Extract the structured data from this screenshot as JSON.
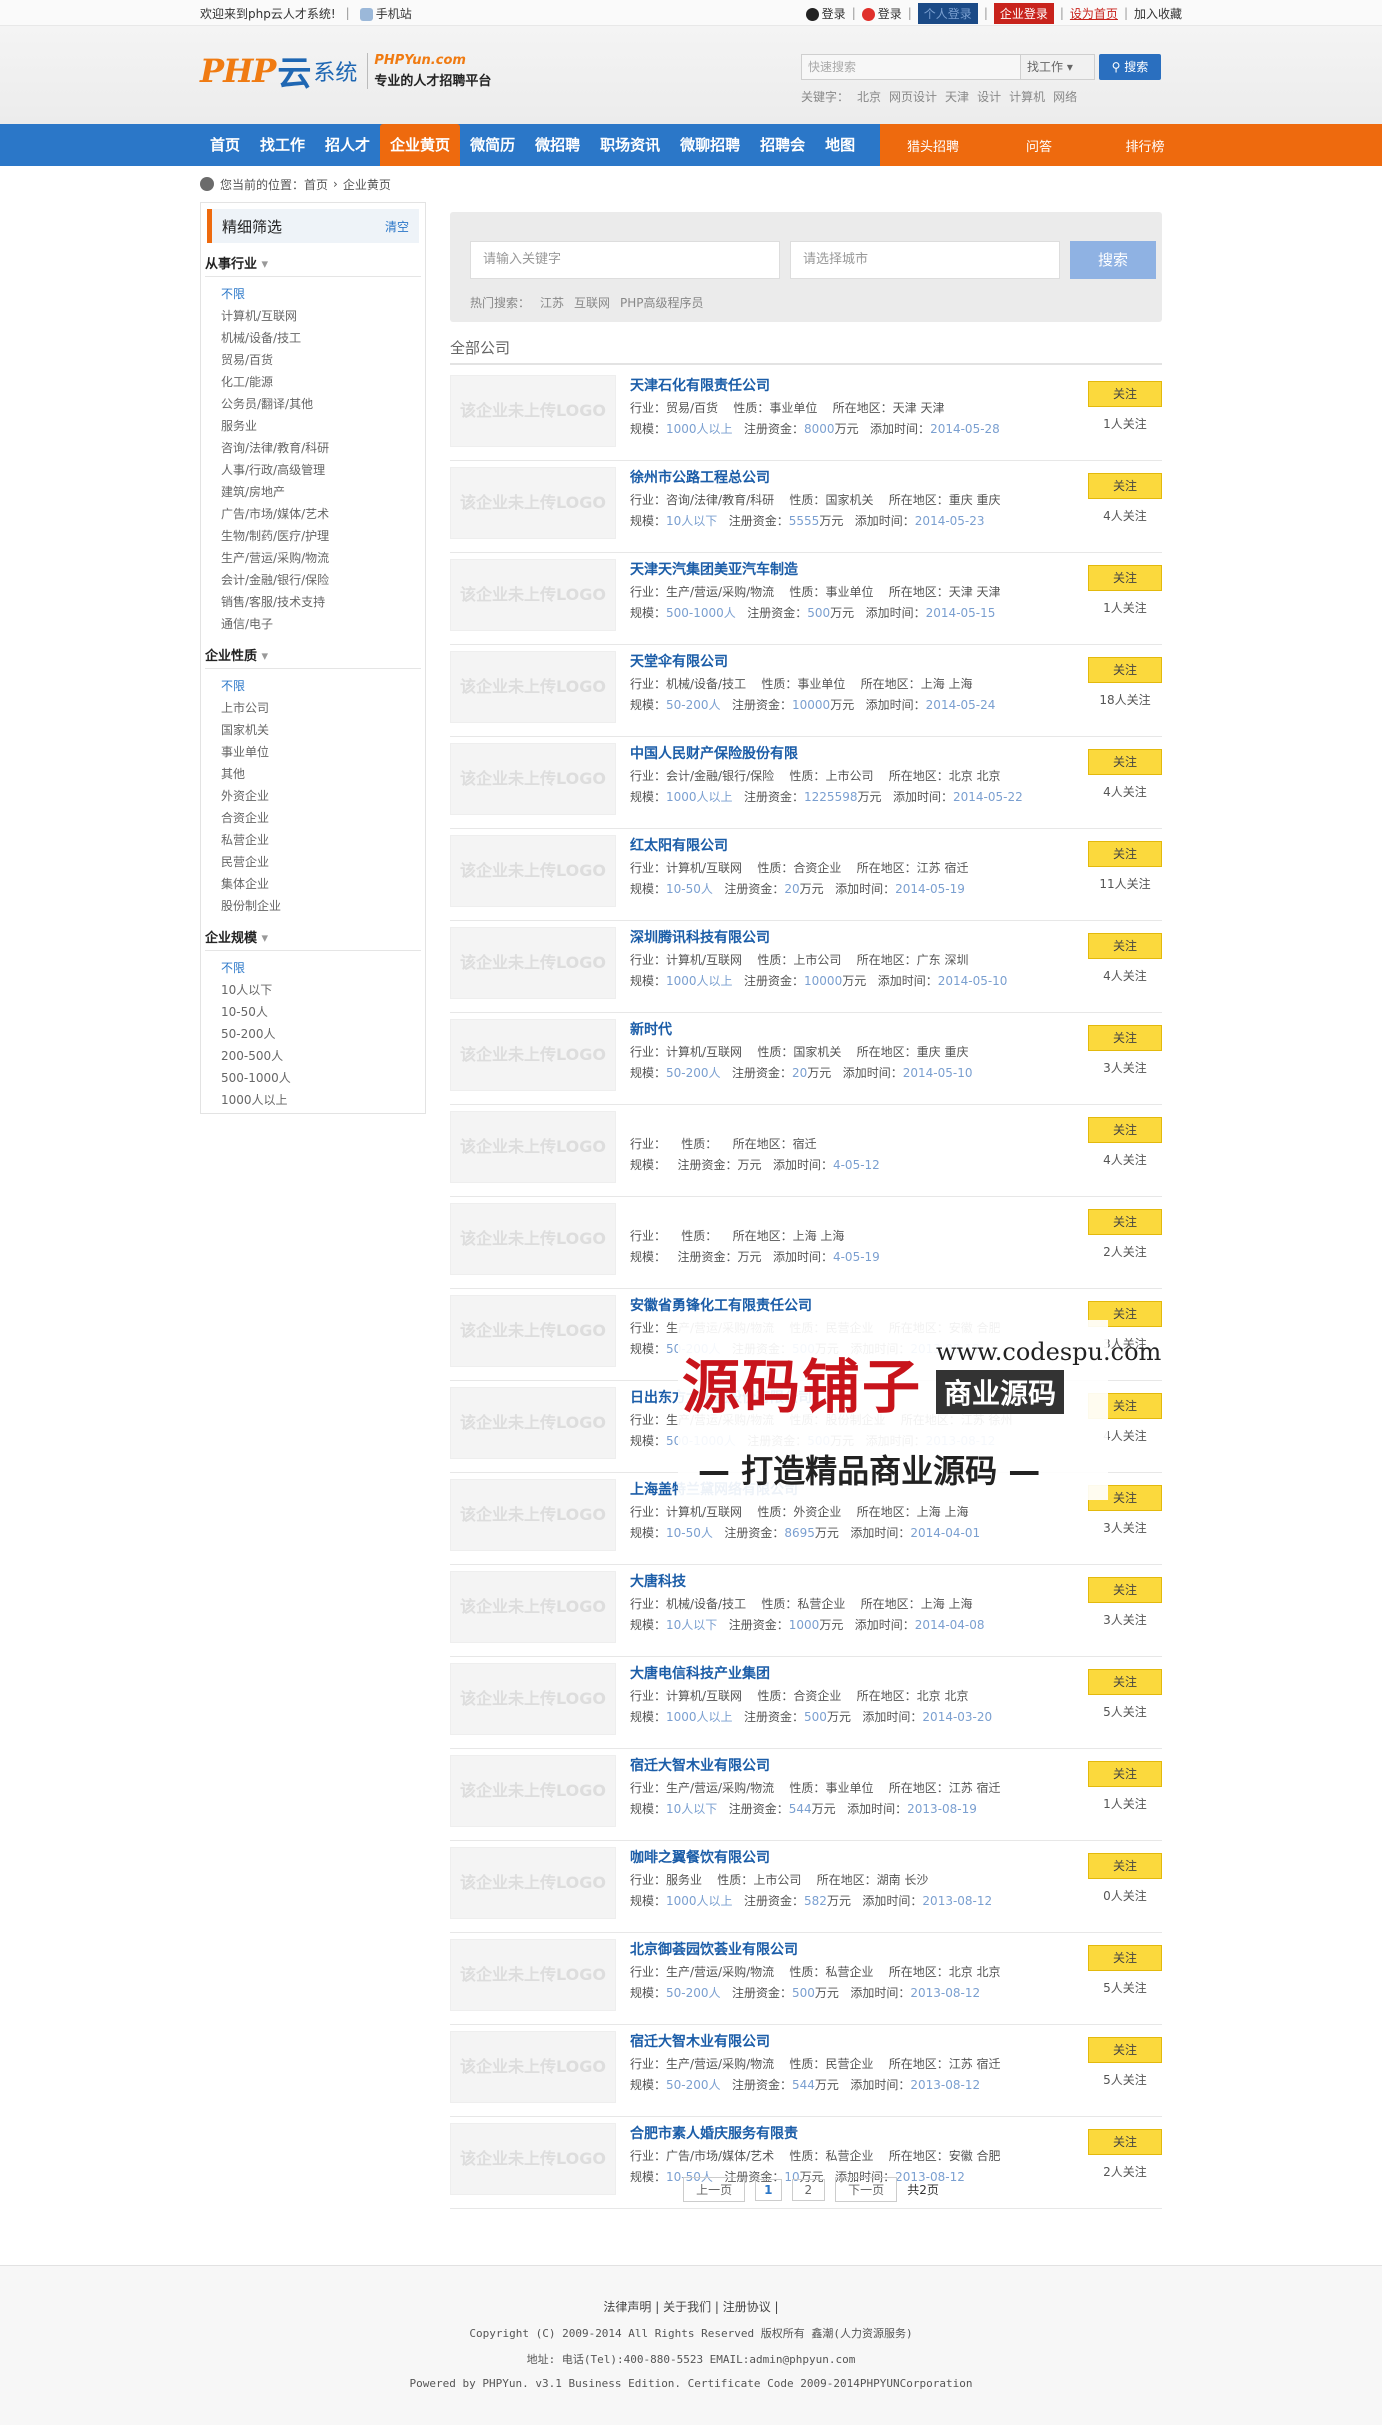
{
  "topbar": {
    "welcome": "欢迎来到php云人才系统!",
    "mobile": "手机站",
    "qq_login": "登录",
    "weibo_login": "登录",
    "personal_login": "个人登录",
    "company_login": "企业登录",
    "set_home": "设为首页",
    "favorite": "加入收藏"
  },
  "header": {
    "logo_php": "PHP",
    "logo_yun": "云",
    "logo_sys": "系统",
    "domain": "PHPYun.com",
    "slogan": "专业的人才招聘平台"
  },
  "topsearch": {
    "placeholder": "快速搜索",
    "type": "找工作",
    "button": "搜索",
    "kw_label": "关键字：",
    "keywords": [
      "北京",
      "网页设计",
      "天津",
      "设计",
      "计算机",
      "网络"
    ]
  },
  "nav": {
    "items": [
      "首页",
      "找工作",
      "招人才",
      "企业黄页",
      "微简历",
      "微招聘",
      "职场资讯",
      "微聊招聘",
      "招聘会",
      "地图"
    ],
    "right": [
      "猎头招聘",
      "问答",
      "排行榜"
    ]
  },
  "breadcrumb": {
    "label": "您当前的位置：",
    "home": "首页",
    "current": "企业黄页"
  },
  "filter": {
    "title": "精细筛选",
    "clear": "清空",
    "groups": [
      {
        "title": "从事行业",
        "items": [
          "不限",
          "计算机/互联网",
          "机械/设备/技工",
          "贸易/百货",
          "化工/能源",
          "公务员/翻译/其他",
          "服务业",
          "咨询/法律/教育/科研",
          "人事/行政/高级管理",
          "建筑/房地产",
          "广告/市场/媒体/艺术",
          "生物/制药/医疗/护理",
          "生产/营运/采购/物流",
          "会计/金融/银行/保险",
          "销售/客服/技术支持",
          "通信/电子"
        ]
      },
      {
        "title": "企业性质",
        "items": [
          "不限",
          "上市公司",
          "国家机关",
          "事业单位",
          "其他",
          "外资企业",
          "合资企业",
          "私营企业",
          "民营企业",
          "集体企业",
          "股份制企业"
        ]
      },
      {
        "title": "企业规模",
        "items": [
          "不限",
          "10人以下",
          "10-50人",
          "50-200人",
          "200-500人",
          "500-1000人",
          "1000人以上"
        ]
      }
    ]
  },
  "search": {
    "keyword_placeholder": "请输入关键字",
    "city_placeholder": "请选择城市",
    "button": "搜索",
    "hot_label": "热门搜索：",
    "hot": [
      "江苏",
      "互联网",
      "PHP高级程序员"
    ]
  },
  "list": {
    "title": "全部公司",
    "logo_placeholder": "该企业未上传LOGO",
    "follow": "关注",
    "labels": {
      "industry": "行业：",
      "nature": "性质：",
      "area": "所在地区：",
      "scale": "规模：",
      "capital": "注册资金：",
      "unit": "万元",
      "added": "添加时间："
    },
    "companies": [
      {
        "name": "天津石化有限责任公司",
        "industry": "贸易/百货",
        "nature": "事业单位",
        "area": "天津 天津",
        "scale": "1000人以上",
        "capital": "8000",
        "date": "2014-05-28",
        "fans": "1人关注"
      },
      {
        "name": "徐州市公路工程总公司",
        "industry": "咨询/法律/教育/科研",
        "nature": "国家机关",
        "area": "重庆 重庆",
        "scale": "10人以下",
        "capital": "5555",
        "date": "2014-05-23",
        "fans": "4人关注"
      },
      {
        "name": "天津天汽集团美亚汽车制造",
        "industry": "生产/营运/采购/物流",
        "nature": "事业单位",
        "area": "天津 天津",
        "scale": "500-1000人",
        "capital": "500",
        "date": "2014-05-15",
        "fans": "1人关注"
      },
      {
        "name": "天堂伞有限公司",
        "industry": "机械/设备/技工",
        "nature": "事业单位",
        "area": "上海 上海",
        "scale": "50-200人",
        "capital": "10000",
        "date": "2014-05-24",
        "fans": "18人关注"
      },
      {
        "name": "中国人民财产保险股份有限",
        "industry": "会计/金融/银行/保险",
        "nature": "上市公司",
        "area": "北京 北京",
        "scale": "1000人以上",
        "capital": "1225598",
        "date": "2014-05-22",
        "fans": "4人关注"
      },
      {
        "name": "红太阳有限公司",
        "industry": "计算机/互联网",
        "nature": "合资企业",
        "area": "江苏 宿迁",
        "scale": "10-50人",
        "capital": "20",
        "date": "2014-05-19",
        "fans": "11人关注"
      },
      {
        "name": "深圳腾讯科技有限公司",
        "industry": "计算机/互联网",
        "nature": "上市公司",
        "area": "广东 深圳",
        "scale": "1000人以上",
        "capital": "10000",
        "date": "2014-05-10",
        "fans": "4人关注"
      },
      {
        "name": "新时代",
        "industry": "计算机/互联网",
        "nature": "国家机关",
        "area": "重庆 重庆",
        "scale": "50-200人",
        "capital": "20",
        "date": "2014-05-10",
        "fans": "3人关注"
      },
      {
        "name": "",
        "industry": "",
        "nature": "",
        "area": "宿迁",
        "scale": "",
        "capital": "",
        "date": "4-05-12",
        "fans": "4人关注"
      },
      {
        "name": "",
        "industry": "",
        "nature": "",
        "area": "上海 上海",
        "scale": "",
        "capital": "",
        "date": "4-05-19",
        "fans": "2人关注"
      },
      {
        "name": "安徽省勇锋化工有限责任公司",
        "industry": "生产/营运/采购/物流",
        "nature": "民营企业",
        "area": "安徽 合肥",
        "scale": "50-200人",
        "capital": "500",
        "date": "2013-08-12",
        "fans": "3人关注"
      },
      {
        "name": "日出东方太阳能股份有限公司",
        "industry": "生产/营运/采购/物流",
        "nature": "股份制企业",
        "area": "江苏 徐州",
        "scale": "500-1000人",
        "capital": "500",
        "date": "2013-08-12",
        "fans": "4人关注"
      },
      {
        "name": "上海盖特兰黛网络有限公司",
        "industry": "计算机/互联网",
        "nature": "外资企业",
        "area": "上海 上海",
        "scale": "10-50人",
        "capital": "8695",
        "date": "2014-04-01",
        "fans": "3人关注"
      },
      {
        "name": "大唐科技",
        "industry": "机械/设备/技工",
        "nature": "私营企业",
        "area": "上海 上海",
        "scale": "10人以下",
        "capital": "1000",
        "date": "2014-04-08",
        "fans": "3人关注"
      },
      {
        "name": "大唐电信科技产业集团",
        "industry": "计算机/互联网",
        "nature": "合资企业",
        "area": "北京 北京",
        "scale": "1000人以上",
        "capital": "500",
        "date": "2014-03-20",
        "fans": "5人关注"
      },
      {
        "name": "宿迁大智木业有限公司",
        "industry": "生产/营运/采购/物流",
        "nature": "事业单位",
        "area": "江苏 宿迁",
        "scale": "10人以下",
        "capital": "544",
        "date": "2013-08-19",
        "fans": "1人关注"
      },
      {
        "name": "咖啡之翼餐饮有限公司",
        "industry": "服务业",
        "nature": "上市公司",
        "area": "湖南 长沙",
        "scale": "1000人以上",
        "capital": "582",
        "date": "2013-08-12",
        "fans": "0人关注"
      },
      {
        "name": "北京御荟园饮荟业有限公司",
        "industry": "生产/营运/采购/物流",
        "nature": "私营企业",
        "area": "北京 北京",
        "scale": "50-200人",
        "capital": "500",
        "date": "2013-08-12",
        "fans": "5人关注"
      },
      {
        "name": "宿迁大智木业有限公司",
        "industry": "生产/营运/采购/物流",
        "nature": "民营企业",
        "area": "江苏 宿迁",
        "scale": "50-200人",
        "capital": "544",
        "date": "2013-08-12",
        "fans": "5人关注"
      },
      {
        "name": "合肥市素人婚庆服务有限责",
        "industry": "广告/市场/媒体/艺术",
        "nature": "私营企业",
        "area": "安徽 合肥",
        "scale": "10-50人",
        "capital": "10",
        "date": "2013-08-12",
        "fans": "2人关注"
      }
    ]
  },
  "pager": {
    "prev": "上一页",
    "p1": "1",
    "p2": "2",
    "next": "下一页",
    "total": "共2页"
  },
  "footer": {
    "links": "法律声明 | 关于我们 | 注册协议 |",
    "copyright": "Copyright (C) 2009-2014 All Rights Reserved 版权所有 鑫潮(人力资源服务)",
    "address": "地址: 电话(Tel):400-880-5523 EMAIL:admin@phpyun.com",
    "powered": "Powered by PHPYun. v3.1 Business Edition. Certificate Code 2009-2014PHPYUNCorporation"
  },
  "watermark": {
    "big": "源码铺子",
    "url": "www.codespu.com",
    "biz": "商业源码",
    "sub": "— 打造精品商业源码 —"
  },
  "colors": {
    "nav": "#2b77c8",
    "accent": "#ee6a0e",
    "follow": "#fbd93d",
    "link": "#1b5da8"
  }
}
